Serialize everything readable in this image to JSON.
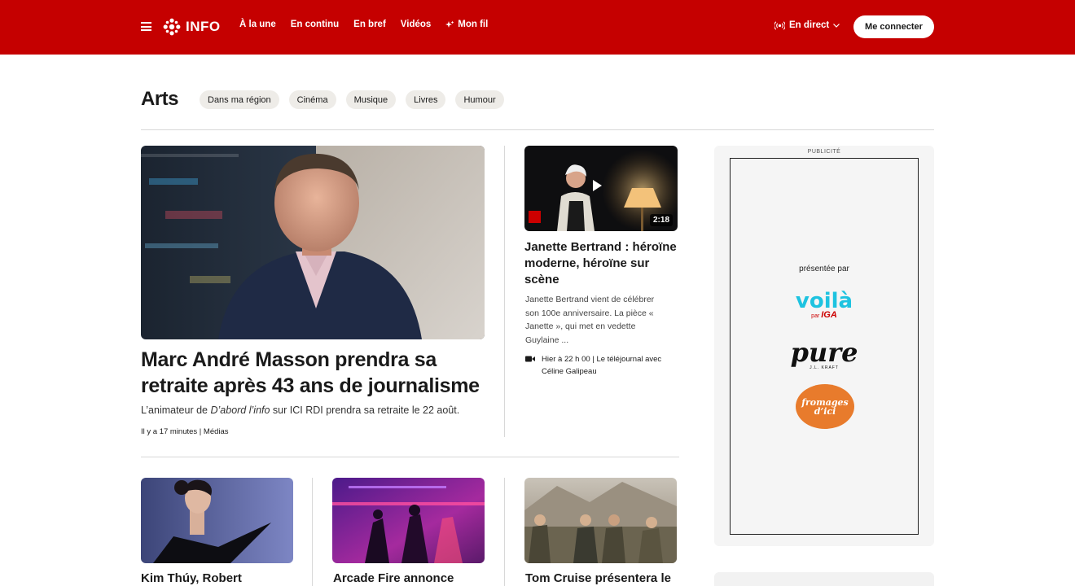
{
  "header": {
    "logo_text": "INFO",
    "nav": [
      "À la une",
      "En continu",
      "En bref",
      "Vidéos",
      "Mon fil"
    ],
    "live_label": "En direct",
    "login_label": "Me connecter",
    "brand_color": "#c50000"
  },
  "section": {
    "title": "Arts",
    "chips": [
      "Dans ma région",
      "Cinéma",
      "Musique",
      "Livres",
      "Humour"
    ]
  },
  "feature": {
    "title": "Marc André Masson prendra sa retraite après 43 ans de journalisme",
    "desc_prefix": "L’animateur de ",
    "desc_show": "D’abord l’info",
    "desc_suffix": " sur ICI RDI prendra sa retraite le 22 août.",
    "time": "Il y a 17 minutes",
    "category": "Médias"
  },
  "side_story": {
    "duration": "2:18",
    "title": "Janette Bertrand : héroïne moderne, héroïne sur scène",
    "desc": "Janette Bertrand vient de célébrer son 100e anniversaire. La pièce « Janette », qui met en vedette Guylaine ...",
    "time": "Hier à 22 h 00",
    "program": "Le téléjournal avec Céline Galipeau"
  },
  "cards": [
    {
      "title": "Kim Thúy, Robert"
    },
    {
      "title": "Arcade Fire annonce"
    },
    {
      "title": "Tom Cruise présentera le"
    }
  ],
  "ad": {
    "label": "PUBLICITÉ",
    "presented_by": "présentée par",
    "sponsors": [
      "voilà",
      "par",
      "IGA",
      "pure",
      "J.L. KRAFT",
      "fromages d’ici"
    ]
  }
}
